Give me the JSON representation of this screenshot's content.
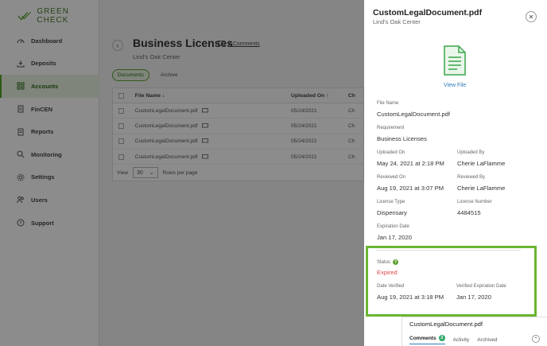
{
  "brand": {
    "name": "GREEN CHECK",
    "accent": "#5aa12f"
  },
  "sidebar": {
    "items": [
      {
        "label": "Dashboard",
        "icon": "dashboard-icon"
      },
      {
        "label": "Deposits",
        "icon": "deposit-icon"
      },
      {
        "label": "Accounts",
        "icon": "accounts-icon",
        "active": true
      },
      {
        "label": "FinCEN",
        "icon": "fincen-icon"
      },
      {
        "label": "Reports",
        "icon": "reports-icon"
      },
      {
        "label": "Monitoring",
        "icon": "monitoring-icon"
      },
      {
        "label": "Settings",
        "icon": "gear-icon"
      },
      {
        "label": "Users",
        "icon": "users-icon"
      },
      {
        "label": "Support",
        "icon": "support-icon"
      }
    ]
  },
  "page": {
    "title": "Business Licenses",
    "comments_label": "2 Comments",
    "subtitle": "Lind's Oak Center",
    "tabs": [
      "Documents",
      "Archive"
    ]
  },
  "table": {
    "headers": {
      "file_name": "File Name ↓",
      "uploaded_on": "Uploaded On ↑",
      "ch": "Ch"
    },
    "rows": [
      {
        "file": "CustomLegalDocument.pdf",
        "uploaded": "05/24/2021",
        "ch": "Ch"
      },
      {
        "file": "CustomLegalDocument.pdf",
        "uploaded": "05/24/2021",
        "ch": "Ch"
      },
      {
        "file": "CustomLegalDocument.pdf",
        "uploaded": "05/24/2021",
        "ch": "Ch"
      },
      {
        "file": "CustomLegalDocument.pdf",
        "uploaded": "05/24/2021",
        "ch": "Ch"
      }
    ],
    "pager": {
      "view_label": "View",
      "value": "30",
      "rows_label": "Rows per page"
    }
  },
  "panel": {
    "title": "CustomLegalDocument.pdf",
    "subtitle": "Lind's Oak Center",
    "view_file": "View File",
    "file_name_label": "File Name",
    "file_name": "CustomLegalDocument.pdf",
    "requirement_label": "Requirement",
    "requirement": "Business Licenses",
    "uploaded_on_label": "Uploaded On",
    "uploaded_on": "May 24, 2021 at 2:18 PM",
    "uploaded_by_label": "Uploaded By",
    "uploaded_by": "Cherie LaFlamme",
    "reviewed_on_label": "Reviewed On",
    "reviewed_on": "Aug 19, 2021 at 3:07 PM",
    "reviewed_by_label": "Reviewed By",
    "reviewed_by": "Cherie LaFlamme",
    "license_type_label": "License Type",
    "license_type": "Dispensary",
    "license_number_label": "License Number",
    "license_number": "4484515",
    "expiration_date_label": "Expiration Date",
    "expiration_date": "Jan 17, 2020",
    "status_label": "Status",
    "status": "Expired",
    "status_color": "#e04848",
    "date_verified_label": "Date Verified",
    "date_verified": "Aug 19, 2021 at 3:18 PM",
    "verified_exp_label": "Verified Expiration Date",
    "verified_exp": "Jan 17, 2020"
  },
  "subpanel": {
    "title": "CustomLegalDocument.pdf",
    "tabs": [
      {
        "label": "Comments",
        "count": "3"
      },
      {
        "label": "Activity"
      },
      {
        "label": "Archived"
      }
    ]
  }
}
